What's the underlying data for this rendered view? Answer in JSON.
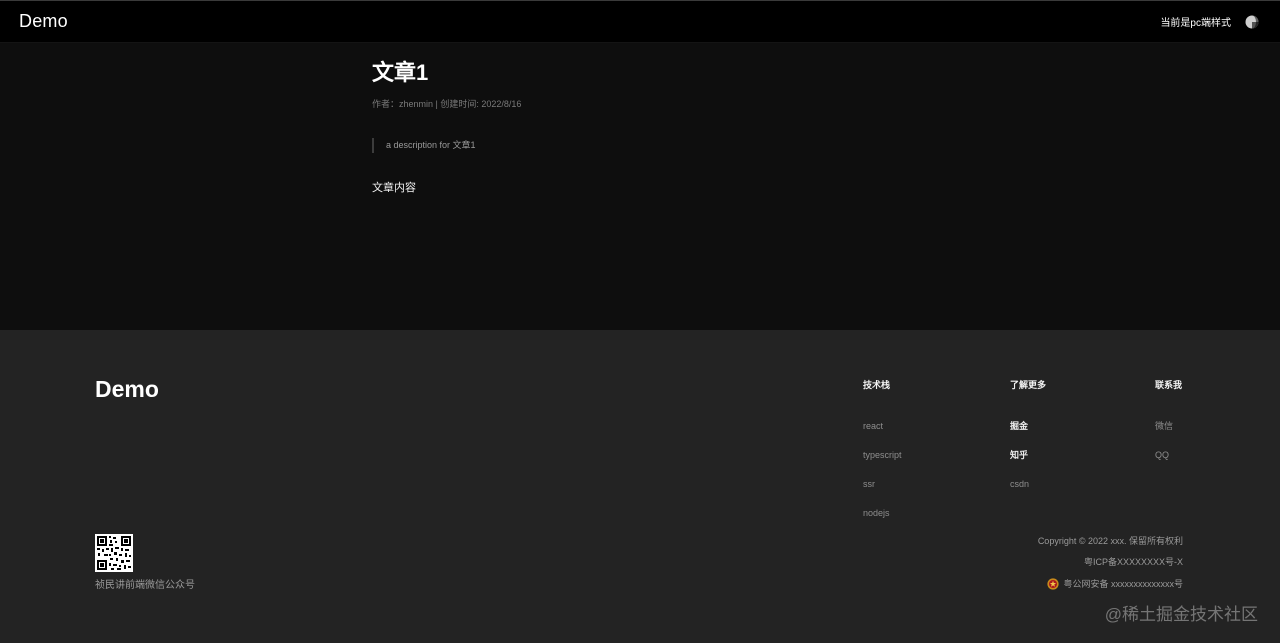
{
  "header": {
    "logo": "Demo",
    "style_mode_text": "当前是pc端样式",
    "theme_icon": "half-moon-icon"
  },
  "article": {
    "title": "文章1",
    "meta": "作者：zhenmin | 创建时间: 2022/8/16",
    "description": "a description for 文章1",
    "body": "文章内容"
  },
  "footer": {
    "logo": "Demo",
    "columns": [
      {
        "title": "技术栈",
        "links": [
          "react",
          "typescript",
          "ssr",
          "nodejs"
        ]
      },
      {
        "title": "了解更多",
        "links": [
          "掘金",
          "知乎",
          "csdn"
        ]
      },
      {
        "title": "联系我",
        "links": [
          "微信",
          "QQ"
        ]
      }
    ],
    "qr_caption": "祯民讲前端微信公众号",
    "copyright": "Copyright © 2022 xxx. 保留所有权利",
    "icp": "粤ICP备XXXXXXXX号-X",
    "police_record": "粤公网安备 xxxxxxxxxxxxxx号",
    "police_icon": "police-badge-icon"
  },
  "watermark": "@稀土掘金技术社区",
  "colors": {
    "header_bg": "#000000",
    "page_bg": "#0e0e0e",
    "footer_bg": "#232323",
    "muted_text": "#8e8e8e"
  }
}
